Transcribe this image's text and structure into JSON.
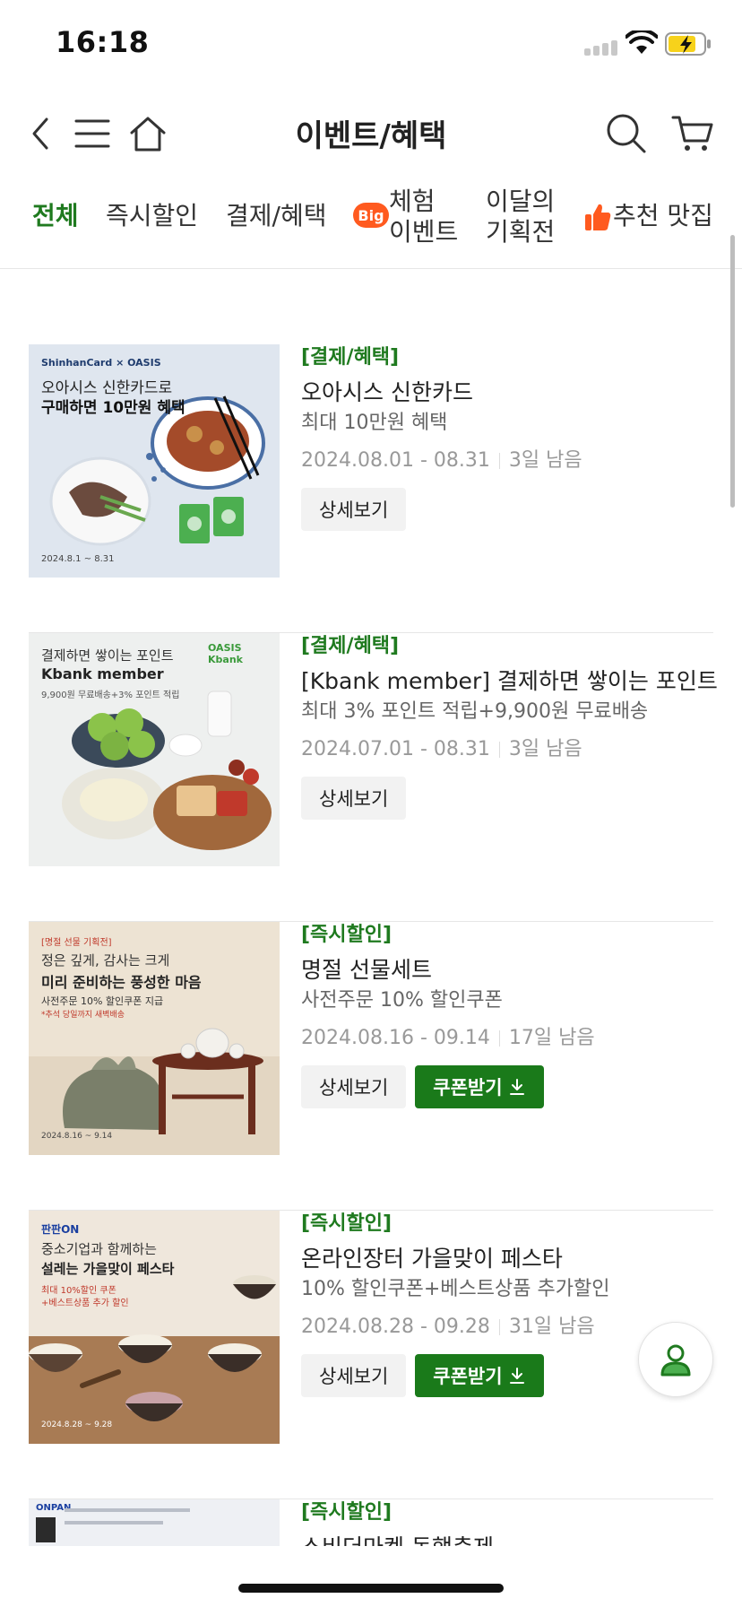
{
  "status": {
    "time": "16:18"
  },
  "header": {
    "title": "이벤트/혜택"
  },
  "tabs": [
    {
      "label": "전체"
    },
    {
      "label": "즉시할인"
    },
    {
      "label": "결제/혜택"
    },
    {
      "label_line1": "체험",
      "label_line2": "이벤트",
      "badge": "Big"
    },
    {
      "label_line1": "이달의",
      "label_line2": "기획전"
    },
    {
      "label": "추천 맛집"
    }
  ],
  "buttons": {
    "detail": "상세보기",
    "coupon": "쿠폰받기"
  },
  "events": [
    {
      "category": "[결제/혜택]",
      "title": "오아시스 신한카드",
      "subtitle": "최대 10만원 혜택",
      "period": "2024.08.01 - 08.31",
      "remaining": "3일 남음",
      "has_coupon": false,
      "image": {
        "brand": "ShinhanCard × OASIS",
        "line1": "오아시스 신한카드로",
        "line2": "구매하면 10만원 혜택",
        "date": "2024.8.1 ~ 8.31",
        "bg": "#dfe6ef"
      }
    },
    {
      "category": "[결제/혜택]",
      "title": "[Kbank member] 결제하면 쌓이는 포인트",
      "subtitle": "최대 3% 포인트 적립+9,900원 무료배송",
      "period": "2024.07.01 - 08.31",
      "remaining": "3일 남음",
      "has_coupon": false,
      "image": {
        "brand": "OASIS Kbank",
        "line1": "결제하면 쌓이는 포인트",
        "line2": "Kbank member",
        "line3": "9,900원 무료배송+3% 포인트 적립",
        "bg": "#eef0ef"
      }
    },
    {
      "category": "[즉시할인]",
      "title": "명절 선물세트",
      "subtitle": "사전주문 10% 할인쿠폰",
      "period": "2024.08.16 - 09.14",
      "remaining": "17일 남음",
      "has_coupon": true,
      "image": {
        "tag": "[명절 선물 기획전]",
        "line1": "정은 깊게, 감사는 크게",
        "line2": "미리 준비하는 풍성한 마음",
        "line3": "사전주문 10% 할인쿠폰 지급",
        "line4": "*추석 당일까지 새벽배송",
        "date": "2024.8.16 ~ 9.14",
        "bg": "#ede3d3"
      }
    },
    {
      "category": "[즉시할인]",
      "title": "온라인장터 가을맞이 페스타",
      "subtitle": "10% 할인쿠폰+베스트상품 추가할인",
      "period": "2024.08.28 - 09.28",
      "remaining": "31일 남음",
      "has_coupon": true,
      "image": {
        "brand": "판판ON",
        "line1": "중소기업과 함께하는",
        "line2": "설레는 가을맞이 페스타",
        "line3": "최대 10%할인 쿠폰",
        "line4": "+베스트상품 추가 할인",
        "date": "2024.8.28 ~ 9.28",
        "bg": "#efe7dc"
      }
    },
    {
      "category": "[즉시할인]",
      "title": "소비더마켓 동행축제",
      "image": {
        "brand": "ONPAN",
        "bg": "#eef0f4"
      }
    }
  ],
  "colors": {
    "accent": "#1f7a1f",
    "coupon_bg": "#1a7a1a",
    "badge": "#ff5a1f"
  }
}
